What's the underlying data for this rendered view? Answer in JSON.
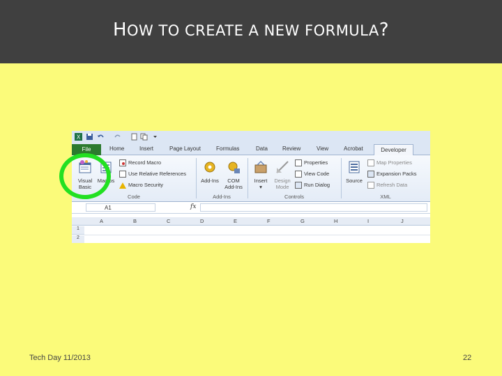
{
  "slide": {
    "title_first_letter": "H",
    "title_rest": "OW TO CREATE A NEW FORMULA",
    "title_end": "?",
    "footer_left": "Tech Day 11/2013",
    "page_number": "22"
  },
  "excel": {
    "tabs": [
      {
        "label": "File",
        "active": false
      },
      {
        "label": "Home"
      },
      {
        "label": "Insert"
      },
      {
        "label": "Page Layout"
      },
      {
        "label": "Formulas"
      },
      {
        "label": "Data"
      },
      {
        "label": "Review"
      },
      {
        "label": "View"
      },
      {
        "label": "Acrobat"
      },
      {
        "label": "Developer",
        "active": true
      }
    ],
    "code_group": {
      "visual_basic_line1": "Visual",
      "visual_basic_line2": "Basic",
      "macros": "Macros",
      "record_macro": "Record Macro",
      "use_relative_references": "Use Relative References",
      "macro_security": "Macro Security",
      "label": "Code"
    },
    "addins_group": {
      "add_ins": "Add-Ins",
      "com_line1": "COM",
      "com_line2": "Add-Ins",
      "label": "Add-Ins"
    },
    "controls_group": {
      "insert": "Insert",
      "design_line1": "Design",
      "design_line2": "Mode",
      "properties": "Properties",
      "view_code": "View Code",
      "run_dialog": "Run Dialog",
      "label": "Controls"
    },
    "xml_group": {
      "source": "Source",
      "map_properties": "Map Properties",
      "expansion_packs": "Expansion Packs",
      "refresh_data": "Refresh Data",
      "label": "XML"
    },
    "name_box": "A1",
    "fx_label": "fx",
    "columns": [
      "A",
      "B",
      "C",
      "D",
      "E",
      "F",
      "G",
      "H",
      "I",
      "J"
    ],
    "rows": [
      "1",
      "2"
    ]
  },
  "colors": {
    "slide_background": "#FBFB7A",
    "title_bar": "#404040",
    "file_tab": "#2C7A2E",
    "highlight_circle": "#22E022"
  }
}
